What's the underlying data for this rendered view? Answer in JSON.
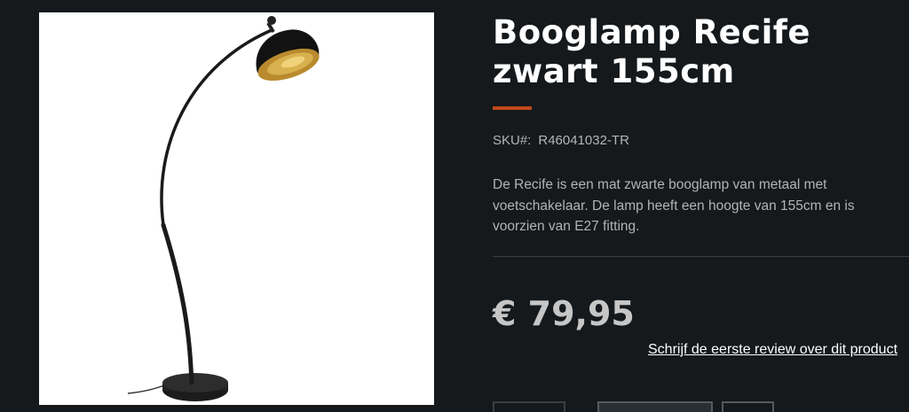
{
  "product": {
    "title_line1": "Booglamp Recife",
    "title_line2": "zwart 155cm",
    "sku_label": "SKU#:",
    "sku_value": "R46041032-TR",
    "description": "De Recife is een mat zwarte booglamp van metaal met voetschakelaar. De lamp heeft een hoogte van 155cm en is voorzien van E27 fitting.",
    "price": "€ 79,95",
    "review_link": "Schrijf de eerste review over dit product"
  },
  "colors": {
    "background": "#15191c",
    "accent": "#c0461c",
    "price": "#c6c6c6"
  },
  "image": {
    "subject": "black arc floor lamp with gold-lined shade"
  }
}
